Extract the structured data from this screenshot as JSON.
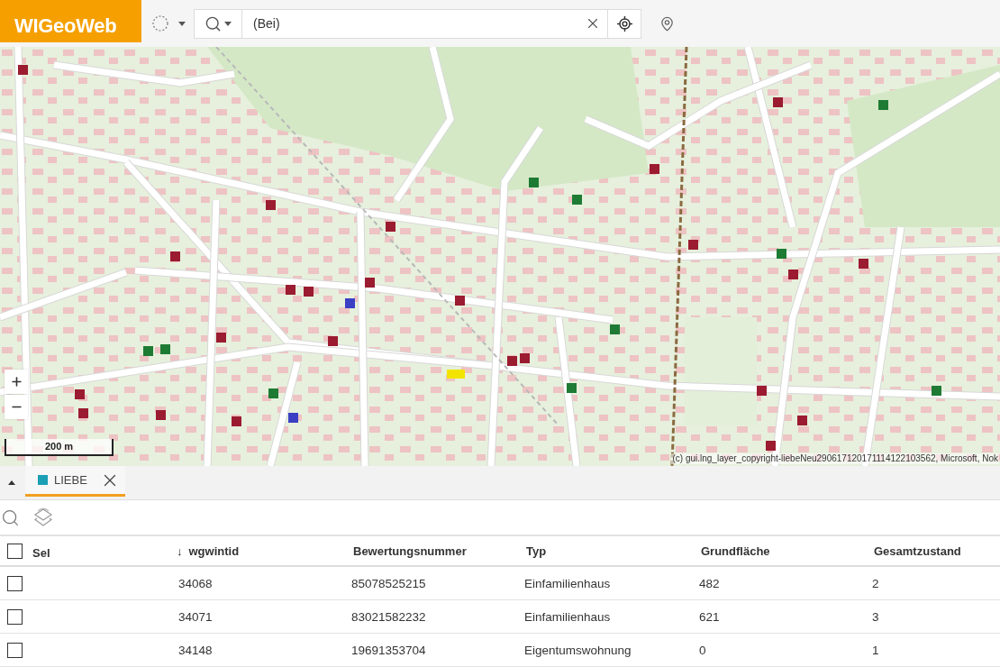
{
  "header": {
    "logo": "WIGeoWeb",
    "search": {
      "value": "(Bei)"
    }
  },
  "map": {
    "markers": [
      {
        "color": "#9b1b30"
      },
      {
        "color": "#9b1b30"
      },
      {
        "color": "#9b1b30"
      },
      {
        "color": "#9b1b30"
      },
      {
        "color": "#9b1b30"
      },
      {
        "color": "#9b1b30"
      },
      {
        "color": "#9b1b30"
      },
      {
        "color": "#3a3fc4"
      },
      {
        "color": "#9b1b30"
      },
      {
        "color": "#9b1b30"
      },
      {
        "color": "#9b1b30"
      },
      {
        "color": "#1e7b34"
      },
      {
        "color": "#1e7b34"
      },
      {
        "color": "#9b1b30"
      },
      {
        "color": "#9b1b30"
      },
      {
        "color": "#f2e400"
      },
      {
        "color": "#1e7b34"
      },
      {
        "color": "#1e7b34"
      },
      {
        "color": "#1e7b34"
      },
      {
        "color": "#1e7b34"
      },
      {
        "color": "#9b1b30"
      },
      {
        "color": "#9b1b30"
      },
      {
        "color": "#1e7b34"
      },
      {
        "color": "#9b1b30"
      },
      {
        "color": "#1e7b34"
      },
      {
        "color": "#9b1b30"
      },
      {
        "color": "#9b1b30"
      },
      {
        "color": "#9b1b30"
      },
      {
        "color": "#9b1b30"
      },
      {
        "color": "#9b1b30"
      },
      {
        "color": "#9b1b30"
      },
      {
        "color": "#1e7b34"
      },
      {
        "color": "#3a3fc4"
      },
      {
        "color": "#9b1b30"
      },
      {
        "color": "#9b1b30"
      },
      {
        "color": "#9b1b30"
      },
      {
        "color": "#1e7b34"
      }
    ],
    "scale": "200 m",
    "attribution": "(c) gui.lng_layer_copyright-liebeNeu290617120171114122103562, Microsoft, Nok"
  },
  "panel": {
    "tabs": [
      {
        "label": "LIEBE",
        "color": "#1a9fb5",
        "selected": true
      }
    ],
    "table": {
      "all_checked": false,
      "columns": [
        {
          "label": "Sel"
        },
        {
          "label": "wgwintid",
          "sort_mark": "↓"
        },
        {
          "label": "Bewertungsnummer"
        },
        {
          "label": "Typ"
        },
        {
          "label": "Grundfläche"
        },
        {
          "label": "Gesamtzustand"
        }
      ],
      "rows": [
        {
          "checked": false,
          "cells": [
            "",
            "34068",
            "85078525215",
            "Einfamilienhaus",
            "482",
            "2"
          ]
        },
        {
          "checked": false,
          "cells": [
            "",
            "34071",
            "83021582232",
            "Einfamilienhaus",
            "621",
            "3"
          ]
        },
        {
          "checked": false,
          "cells": [
            "",
            "34148",
            "19691353704",
            "Eigentumswohnung",
            "0",
            "1"
          ]
        }
      ]
    }
  }
}
